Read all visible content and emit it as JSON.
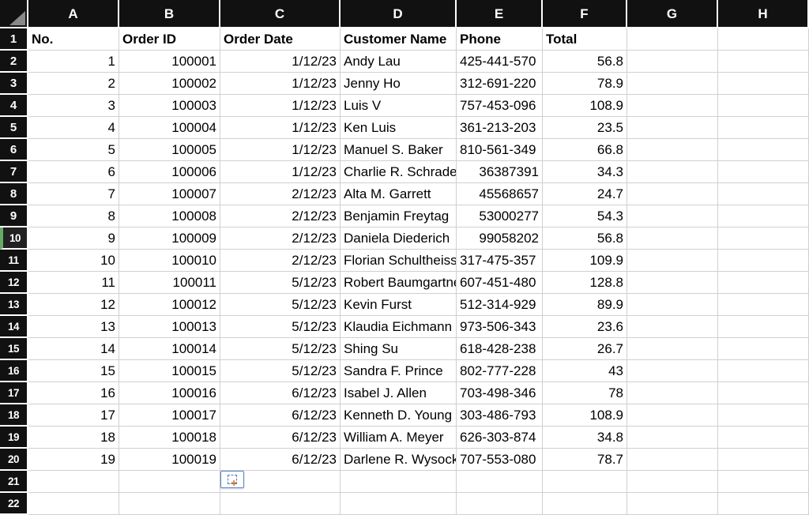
{
  "columns": [
    "A",
    "B",
    "C",
    "D",
    "E",
    "F",
    "G",
    "H"
  ],
  "row_numbers": [
    1,
    2,
    3,
    4,
    5,
    6,
    7,
    8,
    9,
    10,
    11,
    12,
    13,
    14,
    15,
    16,
    17,
    18,
    19,
    20,
    21,
    22
  ],
  "selected_row_header": 10,
  "headers": {
    "A": "No.",
    "B": "Order ID",
    "C": "Order Date",
    "D": "Customer Name",
    "E": "Phone",
    "F": "Total"
  },
  "rows": [
    {
      "no": "1",
      "order_id": "100001",
      "order_date": "1/12/23",
      "customer": "Andy Lau",
      "phone": "425-441-570",
      "phone_kind": "text",
      "total": "56.8"
    },
    {
      "no": "2",
      "order_id": "100002",
      "order_date": "1/12/23",
      "customer": "Jenny Ho",
      "phone": "312-691-220",
      "phone_kind": "text",
      "total": "78.9"
    },
    {
      "no": "3",
      "order_id": "100003",
      "order_date": "1/12/23",
      "customer": "Luis V",
      "phone": "757-453-096",
      "phone_kind": "text",
      "total": "108.9"
    },
    {
      "no": "4",
      "order_id": "100004",
      "order_date": "1/12/23",
      "customer": "Ken Luis",
      "phone": "361-213-203",
      "phone_kind": "text",
      "total": "23.5"
    },
    {
      "no": "5",
      "order_id": "100005",
      "order_date": "1/12/23",
      "customer": "Manuel S. Baker",
      "phone": "810-561-349",
      "phone_kind": "text",
      "total": "66.8"
    },
    {
      "no": "6",
      "order_id": "100006",
      "order_date": "1/12/23",
      "customer": "Charlie R. Schrader",
      "phone": "36387391",
      "phone_kind": "num",
      "total": "34.3"
    },
    {
      "no": "7",
      "order_id": "100007",
      "order_date": "2/12/23",
      "customer": "Alta M. Garrett",
      "phone": "45568657",
      "phone_kind": "num",
      "total": "24.7"
    },
    {
      "no": "8",
      "order_id": "100008",
      "order_date": "2/12/23",
      "customer": "Benjamin Freytag",
      "phone": "53000277",
      "phone_kind": "num",
      "total": "54.3"
    },
    {
      "no": "9",
      "order_id": "100009",
      "order_date": "2/12/23",
      "customer": "Daniela Diederich",
      "phone": "99058202",
      "phone_kind": "num",
      "total": "56.8"
    },
    {
      "no": "10",
      "order_id": "100010",
      "order_date": "2/12/23",
      "customer": "Florian Schultheiss",
      "phone": "317-475-357",
      "phone_kind": "text",
      "total": "109.9"
    },
    {
      "no": "11",
      "order_id": "100011",
      "order_date": "5/12/23",
      "customer": "Robert Baumgartner",
      "phone": "607-451-480",
      "phone_kind": "text",
      "total": "128.8"
    },
    {
      "no": "12",
      "order_id": "100012",
      "order_date": "5/12/23",
      "customer": "Kevin Furst",
      "phone": "512-314-929",
      "phone_kind": "text",
      "total": "89.9"
    },
    {
      "no": "13",
      "order_id": "100013",
      "order_date": "5/12/23",
      "customer": "Klaudia Eichmann",
      "phone": "973-506-343",
      "phone_kind": "text",
      "total": "23.6"
    },
    {
      "no": "14",
      "order_id": "100014",
      "order_date": "5/12/23",
      "customer": "Shing Su",
      "phone": "618-428-238",
      "phone_kind": "text",
      "total": "26.7"
    },
    {
      "no": "15",
      "order_id": "100015",
      "order_date": "5/12/23",
      "customer": "Sandra F. Prince",
      "phone": "802-777-228",
      "phone_kind": "text",
      "total": "43"
    },
    {
      "no": "16",
      "order_id": "100016",
      "order_date": "6/12/23",
      "customer": "Isabel J. Allen",
      "phone": "703-498-346",
      "phone_kind": "text",
      "total": "78"
    },
    {
      "no": "17",
      "order_id": "100017",
      "order_date": "6/12/23",
      "customer": "Kenneth D. Young",
      "phone": "303-486-793",
      "phone_kind": "text",
      "total": "108.9"
    },
    {
      "no": "18",
      "order_id": "100018",
      "order_date": "6/12/23",
      "customer": "William A. Meyer",
      "phone": "626-303-874",
      "phone_kind": "text",
      "total": "34.8"
    },
    {
      "no": "19",
      "order_id": "100019",
      "order_date": "6/12/23",
      "customer": "Darlene R. Wysocki",
      "phone": "707-553-080",
      "phone_kind": "text",
      "total": "78.7"
    }
  ],
  "empty_rows": 2,
  "autofill_button": true
}
